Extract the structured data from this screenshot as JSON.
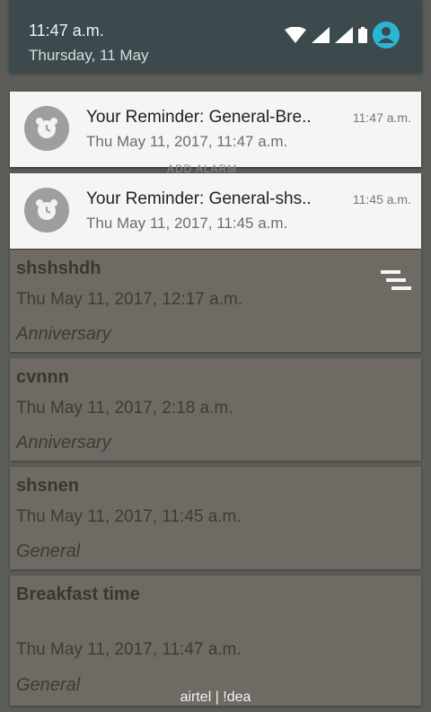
{
  "status": {
    "time": "11:47 a.m.",
    "date": "Thursday, 11 May",
    "icons": [
      "wifi-icon",
      "signal-icon",
      "signal-icon",
      "battery-icon",
      "user-avatar-icon"
    ],
    "accent_color": "#29b6d5"
  },
  "notifications": [
    {
      "title": "Your Reminder: General-Bre..",
      "subtitle": "Thu May 11, 2017, 11:47 a.m.",
      "time": "11:47 a.m.",
      "icon": "alarm-clock-icon"
    },
    {
      "title": "Your Reminder: General-shs..",
      "subtitle": "Thu May 11, 2017, 11:45 a.m.",
      "time": "11:45 a.m.",
      "icon": "alarm-clock-icon"
    }
  ],
  "peek_text": "ADD ALARM",
  "reminders": [
    {
      "title": "shshshdh",
      "date": "Thu May 11, 2017, 12:17 a.m.",
      "category": "Anniversary"
    },
    {
      "title": "cvnnn",
      "date": "Thu May 11, 2017, 2:18 a.m.",
      "category": "Anniversary"
    },
    {
      "title": "shsnen",
      "date": "Thu May 11, 2017, 11:45 a.m.",
      "category": "General"
    },
    {
      "title": "Breakfast time",
      "date": "Thu May 11, 2017, 11:47 a.m.",
      "category": "General"
    }
  ],
  "menu_icon": "sort-menu-icon",
  "carrier": "airtel | !dea"
}
